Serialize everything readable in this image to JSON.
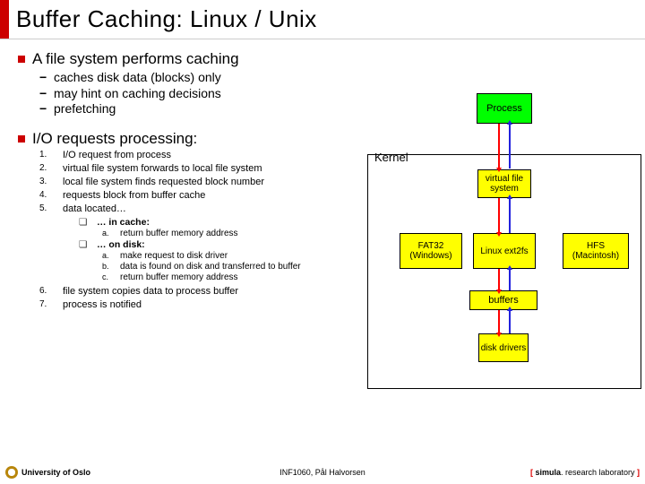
{
  "title": "Buffer Caching: Linux / Unix",
  "bullets": {
    "b1": {
      "text": "A file system performs caching",
      "subs": [
        "caches disk data (blocks) only",
        "may hint on caching decisions",
        "prefetching"
      ]
    },
    "b2": {
      "text": "I/O requests processing:",
      "steps": [
        "I/O request from process",
        "virtual file system forwards to local file system",
        "local file system finds requested block number",
        "requests block from buffer cache",
        "data located…",
        "file system copies data to process buffer",
        "process is notified"
      ],
      "located": {
        "cache": {
          "label": "… in cache:",
          "items": [
            "return buffer memory address"
          ]
        },
        "disk": {
          "label": "… on disk:",
          "items": [
            "make request to disk driver",
            "data is found on disk and transferred to buffer",
            "return buffer memory address"
          ]
        }
      }
    }
  },
  "diagram": {
    "kernel": "Kernel",
    "process": "Process",
    "vfs": "virtual file system",
    "fs": [
      "FAT32 (Windows)",
      "Linux ext2fs",
      "HFS (Macintosh)"
    ],
    "buffers": "buffers",
    "dd": "disk drivers"
  },
  "footer": {
    "left": "University of Oslo",
    "center": "INF1060, Pål Halvorsen",
    "right_parts": [
      "[ ",
      "simula",
      ". research laboratory",
      " ]"
    ]
  }
}
